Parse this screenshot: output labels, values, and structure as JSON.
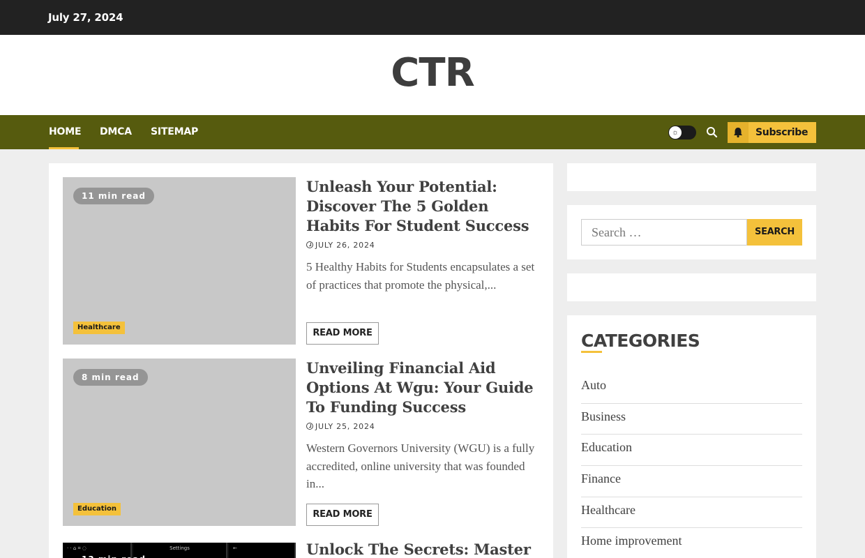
{
  "topbar": {
    "date": "July 27, 2024"
  },
  "site": {
    "title": "CTR"
  },
  "nav": {
    "items": [
      {
        "label": "Home"
      },
      {
        "label": "DMCA"
      },
      {
        "label": "Sitemap"
      }
    ],
    "subscribe_label": "Subscribe"
  },
  "posts": [
    {
      "read_time": "11 min read",
      "category": "Healthcare",
      "title": "Unleash Your Potential: Discover The 5 Golden Habits For Student Success",
      "date": "July 26, 2024",
      "excerpt": "5 Healthy Habits for Students encapsulates a set of practices that promote the physical,...",
      "read_more": "Read More"
    },
    {
      "read_time": "8 min read",
      "category": "Education",
      "title": "Unveiling Financial Aid Options At Wgu: Your Guide To Funding Success",
      "date": "July 25, 2024",
      "excerpt": "Western Governors University (WGU) is a fully accredited, online university that was founded in...",
      "read_more": "Read More"
    },
    {
      "read_time": "13 min read",
      "title": "Unlock The Secrets: Master",
      "thumb_panel_label": "Settings"
    }
  ],
  "sidebar": {
    "search": {
      "placeholder": "Search …",
      "button": "Search"
    },
    "categories": {
      "heading": "Categories",
      "items": [
        "Auto",
        "Business",
        "Education",
        "Finance",
        "Healthcare",
        "Home improvement"
      ]
    }
  },
  "colors": {
    "topbar": "#222222",
    "nav": "#565b0e",
    "accent": "#f4c13b"
  }
}
